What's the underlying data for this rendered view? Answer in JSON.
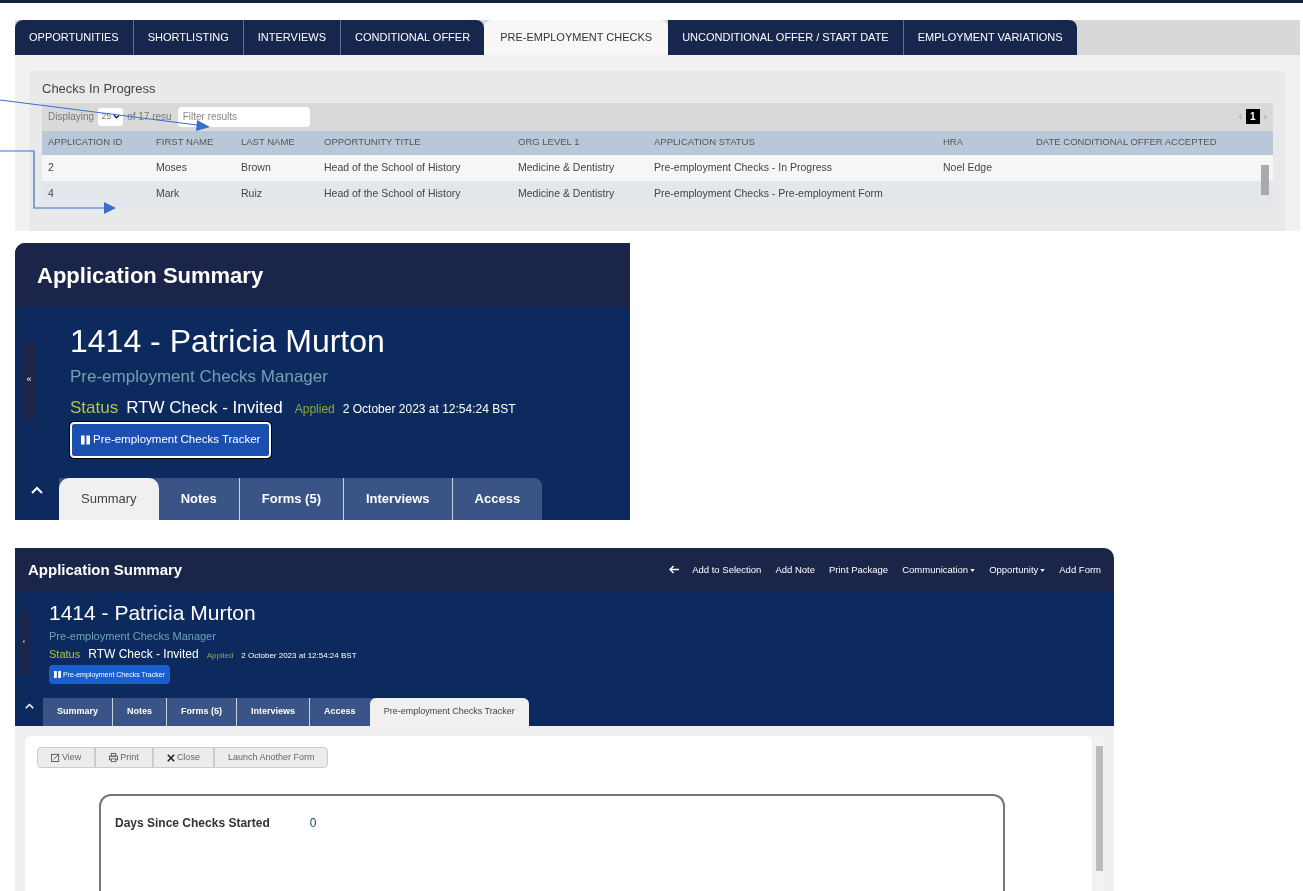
{
  "top_panel": {
    "tabs": [
      {
        "label": "OPPORTUNITIES",
        "selected": false
      },
      {
        "label": "SHORTLISTING",
        "selected": false
      },
      {
        "label": "INTERVIEWS",
        "selected": false
      },
      {
        "label": "CONDITIONAL OFFER",
        "selected": false
      },
      {
        "label": "PRE-EMPLOYMENT CHECKS",
        "selected": true
      },
      {
        "label": "UNCONDITIONAL OFFER / START DATE",
        "selected": false
      },
      {
        "label": "EMPLOYMENT VARIATIONS",
        "selected": false
      }
    ],
    "section_title": "Checks In Progress",
    "displaying_label": "Displaying",
    "page_size": "25",
    "count_text": "of 17 resu",
    "filter": {
      "placeholder": "Filter results"
    },
    "pagination": {
      "prev": "‹",
      "page": "1",
      "next": "›"
    },
    "table": {
      "columns": [
        "APPLICATION ID",
        "FIRST NAME",
        "LAST NAME",
        "OPPORTUNITY TITLE",
        "ORG LEVEL 1",
        "APPLICATION STATUS",
        "HRA",
        "DATE CONDITIONAL OFFER ACCEPTED"
      ],
      "rows": [
        [
          "2",
          "Moses",
          "Brown",
          "Head of the School of History",
          "Medicine & Dentistry",
          "Pre-employment Checks - In Progress",
          "Noel Edge",
          ""
        ],
        [
          "4",
          "Mark",
          "Ruiz",
          "Head of the School of History",
          "Medicine & Dentistry",
          "Pre-employment Checks - Pre-employment Form",
          "",
          ""
        ]
      ]
    }
  },
  "summary_panel": {
    "title": "Application Summary",
    "collapse": "«",
    "heading": "1414 - Patricia Murton",
    "role": "Pre-employment Checks Manager",
    "status_label": "Status",
    "status": "RTW Check - Invited",
    "applied_label": "Applied",
    "applied_date": "2 October 2023 at 12:54:24 BST",
    "tracker_button": "Pre-employment Checks Tracker",
    "tabs": [
      {
        "label": "Summary",
        "selected": true
      },
      {
        "label": "Notes",
        "selected": false
      },
      {
        "label": "Forms (5)",
        "selected": false
      },
      {
        "label": "Interviews",
        "selected": false
      },
      {
        "label": "Access",
        "selected": false
      }
    ]
  },
  "tracker_panel": {
    "title": "Application Summary",
    "actions": [
      {
        "label": "Add to Selection",
        "dropdown": false
      },
      {
        "label": "Add Note",
        "dropdown": false
      },
      {
        "label": "Print Package",
        "dropdown": false
      },
      {
        "label": "Communication",
        "dropdown": true
      },
      {
        "label": "Opportunity",
        "dropdown": true
      },
      {
        "label": "Add Form",
        "dropdown": false
      }
    ],
    "collapse": "‹",
    "heading": "1414 - Patricia Murton",
    "role": "Pre-employment Checks Manager",
    "status_label": "Status",
    "status": "RTW Check - Invited",
    "applied_label": "Applied",
    "applied_date": "2 October 2023 at 12:54:24 BST",
    "tracker_button": "Pre-employment Checks Tracker",
    "tabs": [
      {
        "label": "Summary",
        "selected": false
      },
      {
        "label": "Notes",
        "selected": false
      },
      {
        "label": "Forms (5)",
        "selected": false
      },
      {
        "label": "Interviews",
        "selected": false
      },
      {
        "label": "Access",
        "selected": false
      },
      {
        "label": "Pre-employment Checks Tracker",
        "selected": true
      }
    ],
    "toolbar": [
      {
        "label": "View",
        "kind": "view"
      },
      {
        "label": "Print",
        "kind": "print"
      },
      {
        "label": "Close",
        "kind": "close"
      },
      {
        "label": "Launch Another Form",
        "kind": "plain"
      }
    ],
    "metric": {
      "label": "Days Since Checks Started",
      "value": "0"
    }
  }
}
